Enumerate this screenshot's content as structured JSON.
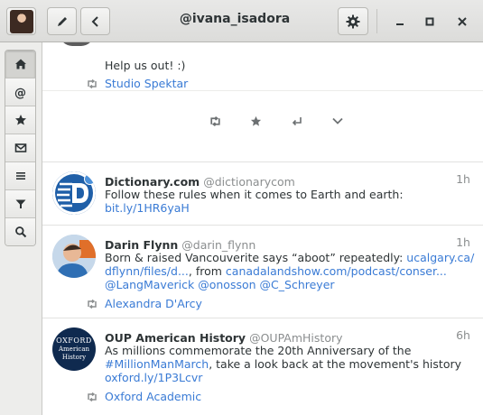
{
  "window": {
    "title": "@ivana_isadora"
  },
  "toolbar": {
    "account_avatar_alt": "",
    "icons": [
      "pencil-icon",
      "chevron-left-icon",
      "gear-icon",
      "minimize-icon",
      "maximize-icon",
      "close-icon"
    ]
  },
  "sidebar": {
    "items": [
      {
        "icon": "home-icon",
        "active": true
      },
      {
        "icon": "at-icon",
        "active": false
      },
      {
        "icon": "star-icon",
        "active": false
      },
      {
        "icon": "mail-icon",
        "active": false
      },
      {
        "icon": "list-icon",
        "active": false
      },
      {
        "icon": "filter-icon",
        "active": false
      },
      {
        "icon": "search-icon",
        "active": false
      }
    ]
  },
  "timeline": {
    "expanded": {
      "text": "Help us out! :)",
      "retweeted_by": "Studio Spektar",
      "actions": [
        "retweet-icon",
        "favorite-icon",
        "reply-icon",
        "more-icon"
      ]
    },
    "tweets": [
      {
        "name": "Dictionary.com",
        "handle": "@dictionarycom",
        "time": "1h",
        "line1": "Follow these rules when it comes to Earth and earth:",
        "link1": "bit.ly/1HR6yaH"
      },
      {
        "name": "Darin Flynn",
        "handle": "@darin_flynn",
        "time": "1h",
        "line1_text": "Born & raised Vancouverite says “aboot” repeatedly: ",
        "line1_link": "ucalgary.ca/",
        "line2_link": "dflynn/files/d...",
        "line2_text": ", from ",
        "line2_link2": "canadalandshow.com/podcast/conser...",
        "line3_links": [
          "@LangMaverick",
          "@onosson",
          "@C_Schreyer"
        ],
        "retweeted_by": "Alexandra D'Arcy"
      },
      {
        "name": "OUP American History",
        "handle": "@OUPAmHistory",
        "time": "6h",
        "line1": "As millions commemorate the 20th Anniversary of the",
        "line2_link": "#MillionManMarch",
        "line2_text": ", take a look back at the movement's history",
        "line3_link": "oxford.ly/1P3Lcvr",
        "retweeted_by": "Oxford Academic",
        "avatar_text1": "OXFORD",
        "avatar_text2": "American",
        "avatar_text3": "History"
      }
    ]
  }
}
